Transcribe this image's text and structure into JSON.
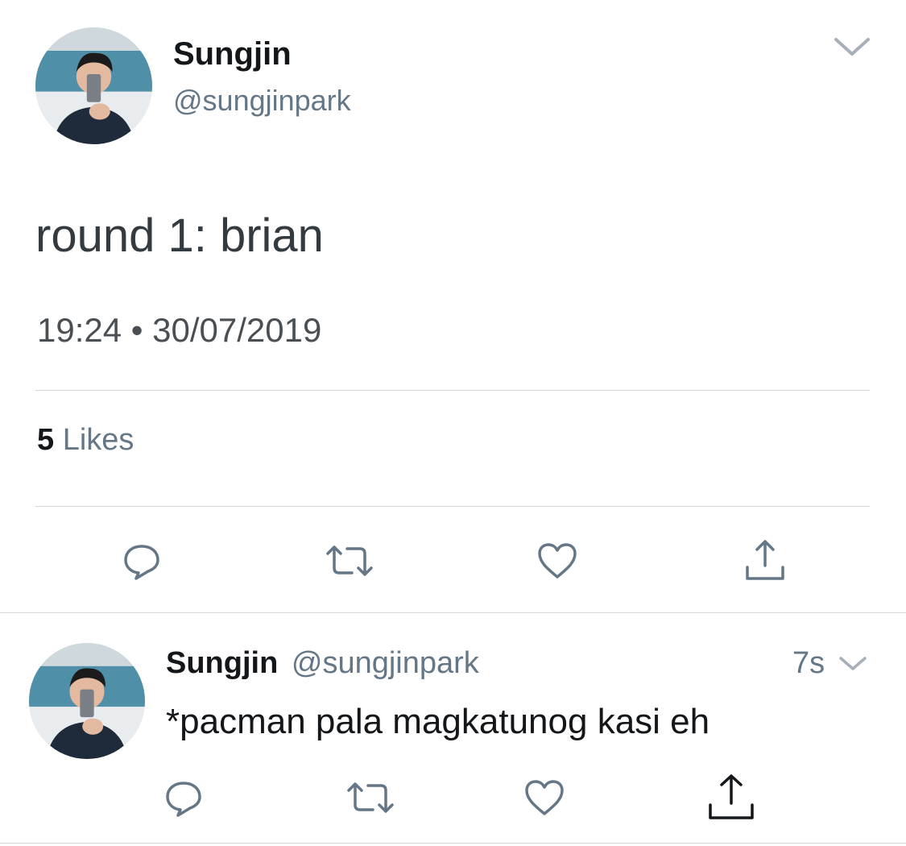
{
  "main_tweet": {
    "display_name": "Sungjin",
    "handle": "@sungjinpark",
    "text": "round 1: brian",
    "timestamp": "19:24 • 30/07/2019",
    "likes_count": "5",
    "likes_label": "Likes",
    "avatar_icon": "avatar-selfie-photo",
    "menu_icon": "chevron-down-icon",
    "actions": [
      "reply-icon",
      "retweet-icon",
      "like-icon",
      "share-icon"
    ]
  },
  "reply_tweet": {
    "display_name": "Sungjin",
    "handle": "@sungjinpark",
    "time_ago": "7s",
    "text": "*pacman pala magkatunog kasi eh",
    "avatar_icon": "avatar-selfie-photo",
    "menu_icon": "chevron-down-icon",
    "actions": [
      "reply-icon",
      "retweet-icon",
      "like-icon",
      "share-icon"
    ]
  },
  "colors": {
    "text_primary": "#14171a",
    "text_secondary": "#657786",
    "icon_gray": "#657786",
    "divider": "#d3d7da"
  }
}
